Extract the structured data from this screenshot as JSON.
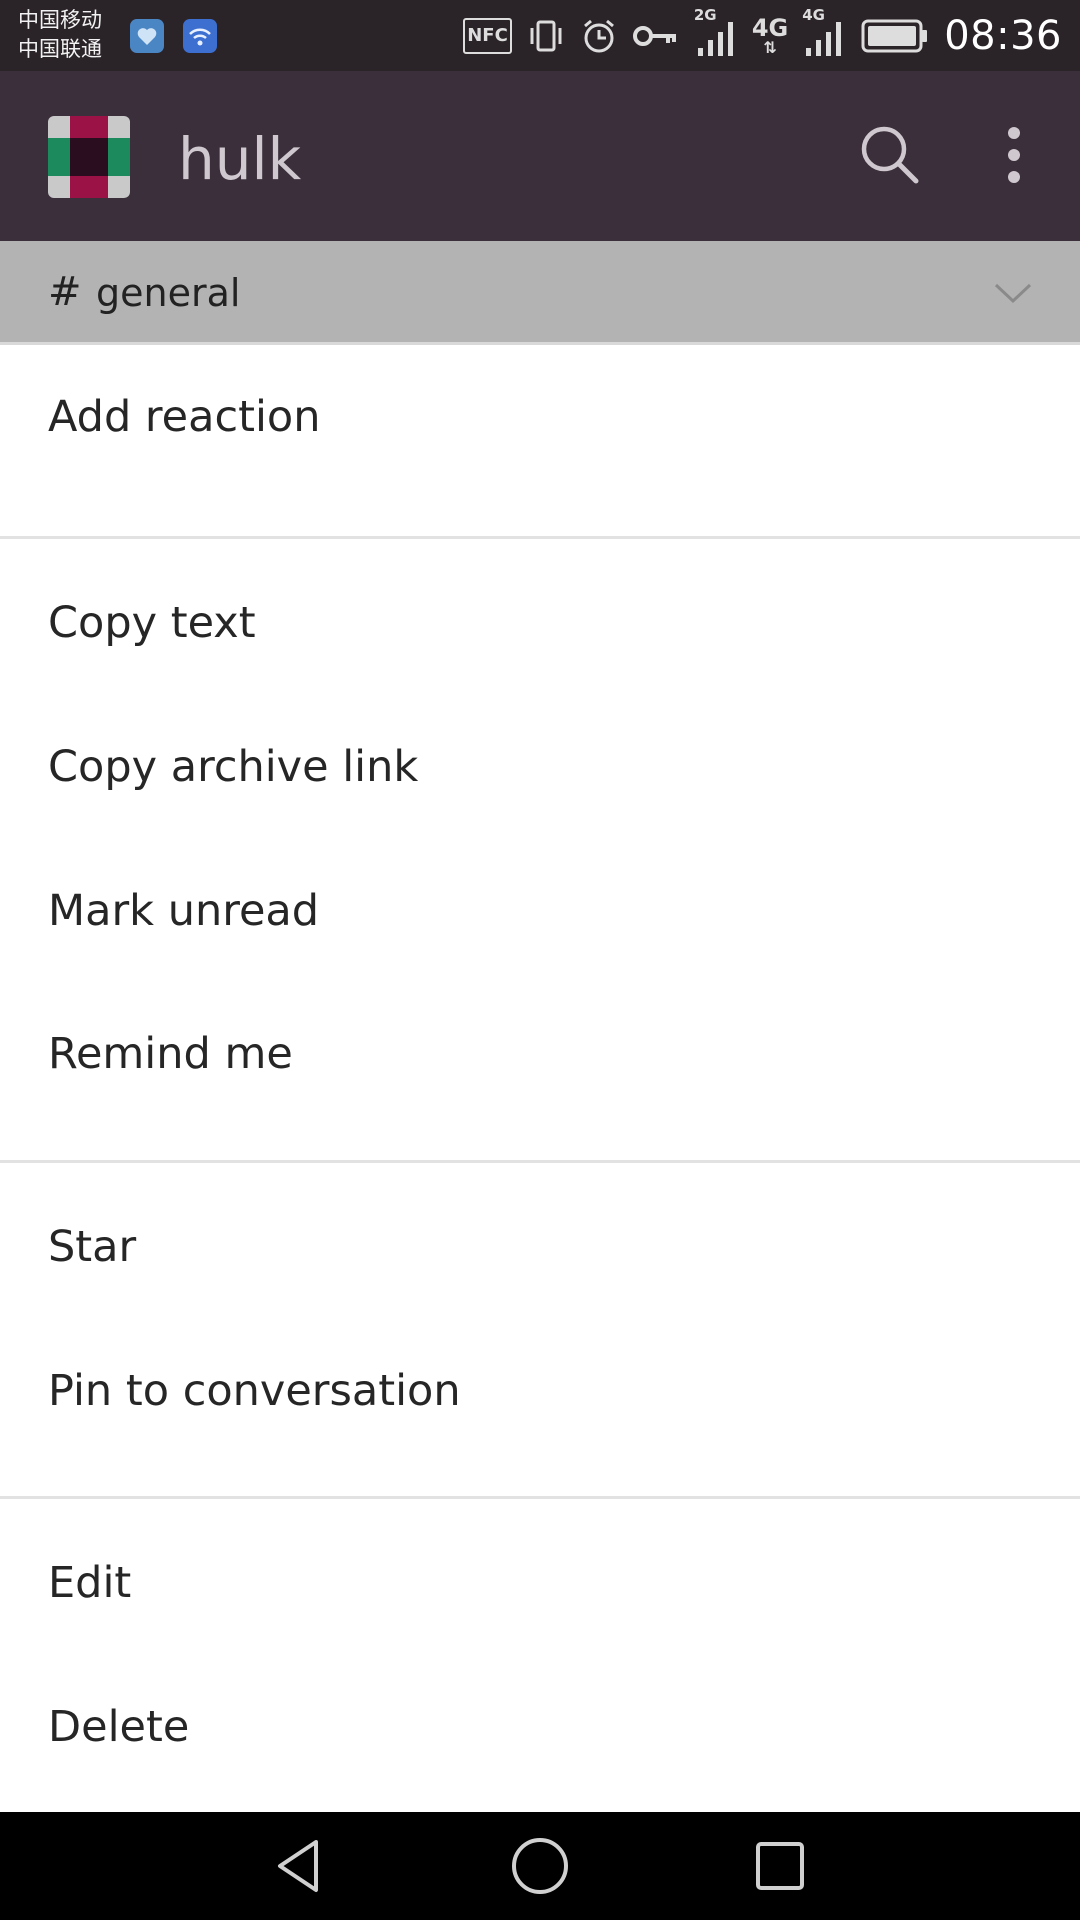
{
  "status_bar": {
    "carrier_1": "中国移动",
    "carrier_2": "中国联通",
    "nfc_label": "NFC",
    "net_2g": "2G",
    "net_4g_a": "4G",
    "net_4g_b": "4G",
    "time": "08:36",
    "icons": [
      "heart-app-icon",
      "wifi-app-icon",
      "nfc-icon",
      "vibrate-icon",
      "alarm-icon",
      "key-icon",
      "signal-icon",
      "battery-icon"
    ]
  },
  "app_bar": {
    "team_name": "hulk",
    "logo_colors": [
      "#9b1346",
      "#1d8a5e",
      "#2a0d1e",
      "#c9c9c9"
    ],
    "icons": [
      "search-icon",
      "more-vert-icon"
    ]
  },
  "channel_bar": {
    "hash": "#",
    "channel": "general",
    "icon": "chevron-down-icon"
  },
  "menu": {
    "items": [
      {
        "label": "Add reaction"
      },
      {
        "label": "Copy text"
      },
      {
        "label": "Copy archive link"
      },
      {
        "label": "Mark unread"
      },
      {
        "label": "Remind me"
      },
      {
        "label": "Star"
      },
      {
        "label": "Pin to conversation"
      },
      {
        "label": "Edit"
      },
      {
        "label": "Delete"
      }
    ]
  },
  "nav_bar": {
    "icons": [
      "back-icon",
      "home-icon",
      "recents-icon"
    ]
  },
  "colors": {
    "status_bar": "#2a2328",
    "app_bar": "#3a2f3b",
    "channel_bar": "#b3b3b3",
    "menu_bg": "#ffffff",
    "nav_bar": "#000000"
  }
}
